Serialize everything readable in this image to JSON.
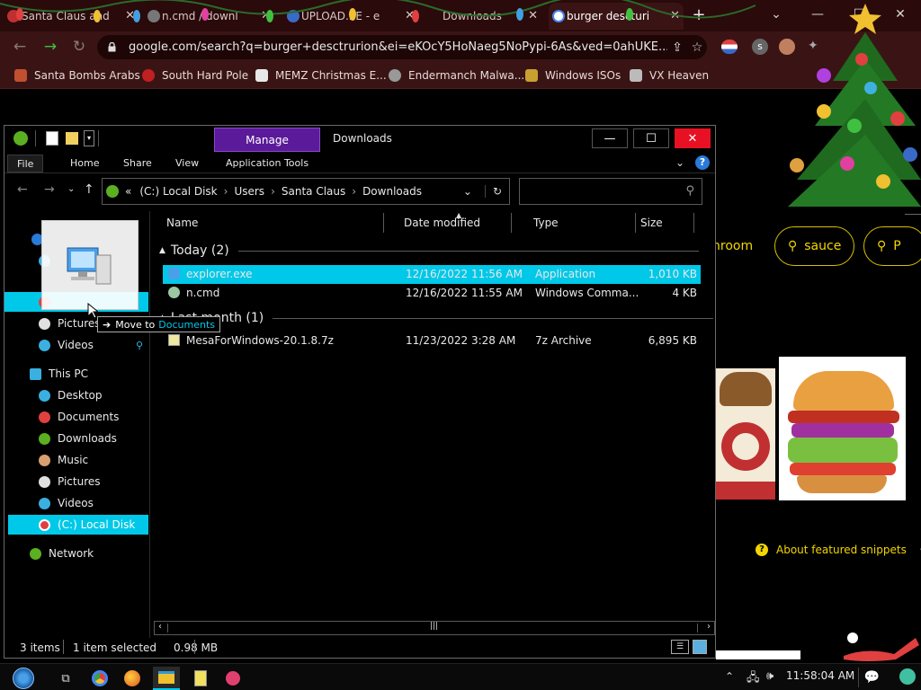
{
  "browser": {
    "tabs": [
      {
        "title": "Santa Claus and",
        "active": false
      },
      {
        "title": "n.cmd / downl",
        "active": false
      },
      {
        "title": "UPLOAD.EE - e",
        "active": false
      },
      {
        "title": "Downloads",
        "active": false
      },
      {
        "title": "burger descturi",
        "active": true
      }
    ],
    "new_tab": "+",
    "url": "google.com/search?q=burger+desctrurion&ei=eKOcY5HoNaeg5NoPypi-6As&ved=0ahUKE...",
    "bookmarks": [
      "Santa Bombs Arabs",
      "South Hard Pole",
      "MEMZ Christmas E...",
      "Endermanch Malwa...",
      "Windows ISOs",
      "VX Heaven"
    ],
    "profile_letter": "s"
  },
  "google": {
    "chips": [
      {
        "label": "hroom",
        "icon": ""
      },
      {
        "label": "sauce",
        "icon": "search-icon"
      },
      {
        "label": "P",
        "icon": "search-icon"
      }
    ],
    "snippets_link": "About featured snippets",
    "snippets_dot": "•"
  },
  "explorer": {
    "title": "Downloads",
    "manage_tab": "Manage",
    "ribbon_tabs": [
      "File",
      "Home",
      "Share",
      "View",
      "Application Tools"
    ],
    "breadcrumb": [
      "«",
      "(C:) Local Disk",
      "Users",
      "Santa Claus",
      "Downloads"
    ],
    "search_placeholder": "",
    "nav": {
      "quick": [
        {
          "label": "",
          "selected": false
        },
        {
          "label": "",
          "selected": false
        },
        {
          "label": "",
          "selected": true
        },
        {
          "label": "Pictures",
          "selected": false
        },
        {
          "label": "Videos",
          "selected": false
        }
      ],
      "this_pc": "This PC",
      "pc_items": [
        {
          "label": "Desktop",
          "color": "#3ab0e0"
        },
        {
          "label": "Documents",
          "color": "#e04040"
        },
        {
          "label": "Downloads",
          "color": "#5ab020"
        },
        {
          "label": "Music",
          "color": "#d8a070"
        },
        {
          "label": "Pictures",
          "color": "#e0e0e0"
        },
        {
          "label": "Videos",
          "color": "#3ab0e0"
        },
        {
          "label": "(C:) Local Disk",
          "color": "#e04040",
          "selected": true
        }
      ],
      "network": "Network"
    },
    "columns": [
      "Name",
      "Date modified",
      "Type",
      "Size"
    ],
    "groups": [
      {
        "label": "Today (2)",
        "files": [
          {
            "name": "explorer.exe",
            "date": "12/16/2022 11:56 AM",
            "type": "Application",
            "size": "1,010 KB",
            "selected": true
          },
          {
            "name": "n.cmd",
            "date": "12/16/2022 11:55 AM",
            "type": "Windows Comma...",
            "size": "4 KB",
            "selected": false
          }
        ]
      },
      {
        "label": "Last month (1)",
        "files": [
          {
            "name": "MesaForWindows-20.1.8.7z",
            "date": "11/23/2022 3:28 AM",
            "type": "7z Archive",
            "size": "6,895 KB",
            "selected": false
          }
        ]
      }
    ],
    "status": {
      "items": "3 items",
      "selection": "1 item selected",
      "size": "0.98 MB"
    },
    "drag_tooltip_prefix": "Move to",
    "drag_tooltip_target": "Documents"
  },
  "taskbar": {
    "clock": "11:58:04 AM"
  },
  "colors": {
    "selection": "#00c8e8",
    "accent_yellow": "#f2d600",
    "manage_purple": "#5a1a9a",
    "close_red": "#e81123"
  }
}
